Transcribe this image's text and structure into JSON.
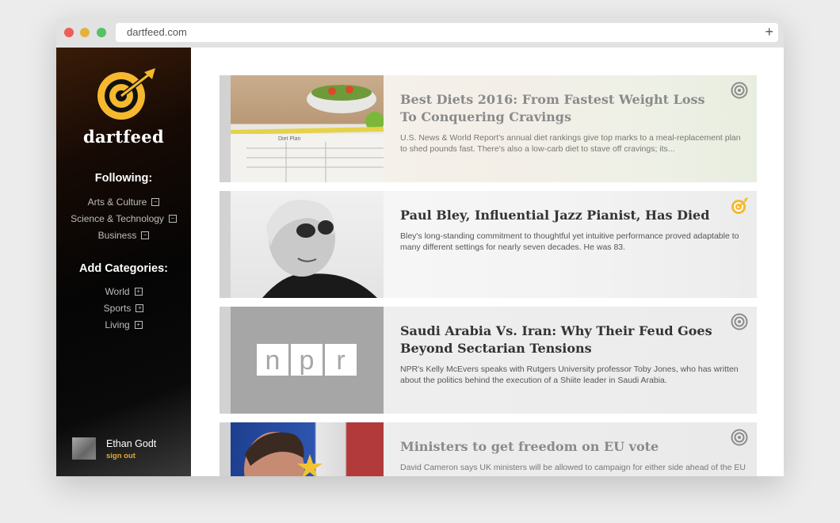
{
  "browser": {
    "url": "dartfeed.com",
    "new_tab": "+"
  },
  "sidebar": {
    "brand": "dartfeed",
    "following_title": "Following:",
    "following": [
      {
        "label": "Arts & Culture",
        "icon": "minus-box-icon"
      },
      {
        "label": "Science & Technology",
        "icon": "minus-box-icon"
      },
      {
        "label": "Business",
        "icon": "minus-box-icon"
      }
    ],
    "add_title": "Add Categories:",
    "categories": [
      {
        "label": "World",
        "icon": "plus-box-icon"
      },
      {
        "label": "Sports",
        "icon": "plus-box-icon"
      },
      {
        "label": "Living",
        "icon": "plus-box-icon"
      }
    ],
    "user": {
      "name": "Ethan Godt",
      "signout": "sign out"
    }
  },
  "articles": [
    {
      "title": "Best Diets 2016: From Fastest Weight Loss To Conquering Cravings",
      "desc": "U.S. News & World Report's annual diet rankings give top marks to a meal-replacement plan to shed pounds fast. There's also a low-carb diet to stave off cravings; its...",
      "thumb_text": "Diet Plan",
      "target_state": "inactive"
    },
    {
      "title": "Paul Bley, Influential Jazz Pianist, Has Died",
      "desc": "Bley's long-standing commitment to thoughtful yet intuitive performance proved adaptable to many different settings for nearly seven decades. He was 83.",
      "target_state": "active"
    },
    {
      "title": "Saudi Arabia Vs. Iran: Why Their Feud Goes Beyond Sectarian Tensions",
      "desc": "NPR's Kelly McEvers speaks with Rutgers University professor Toby Jones, who has written about the politics behind the execution of a Shiite leader in Saudi Arabia.",
      "thumb_text": [
        "n",
        "p",
        "r"
      ],
      "target_state": "inactive"
    },
    {
      "title": "Ministers to get freedom on EU vote",
      "desc": "David Cameron says UK ministers will be allowed to campaign for either side ahead of the EU",
      "target_state": "inactive"
    }
  ],
  "colors": {
    "accent": "#f5b82e",
    "signout": "#e6a82b",
    "target_inactive": "#8c8c8c"
  }
}
